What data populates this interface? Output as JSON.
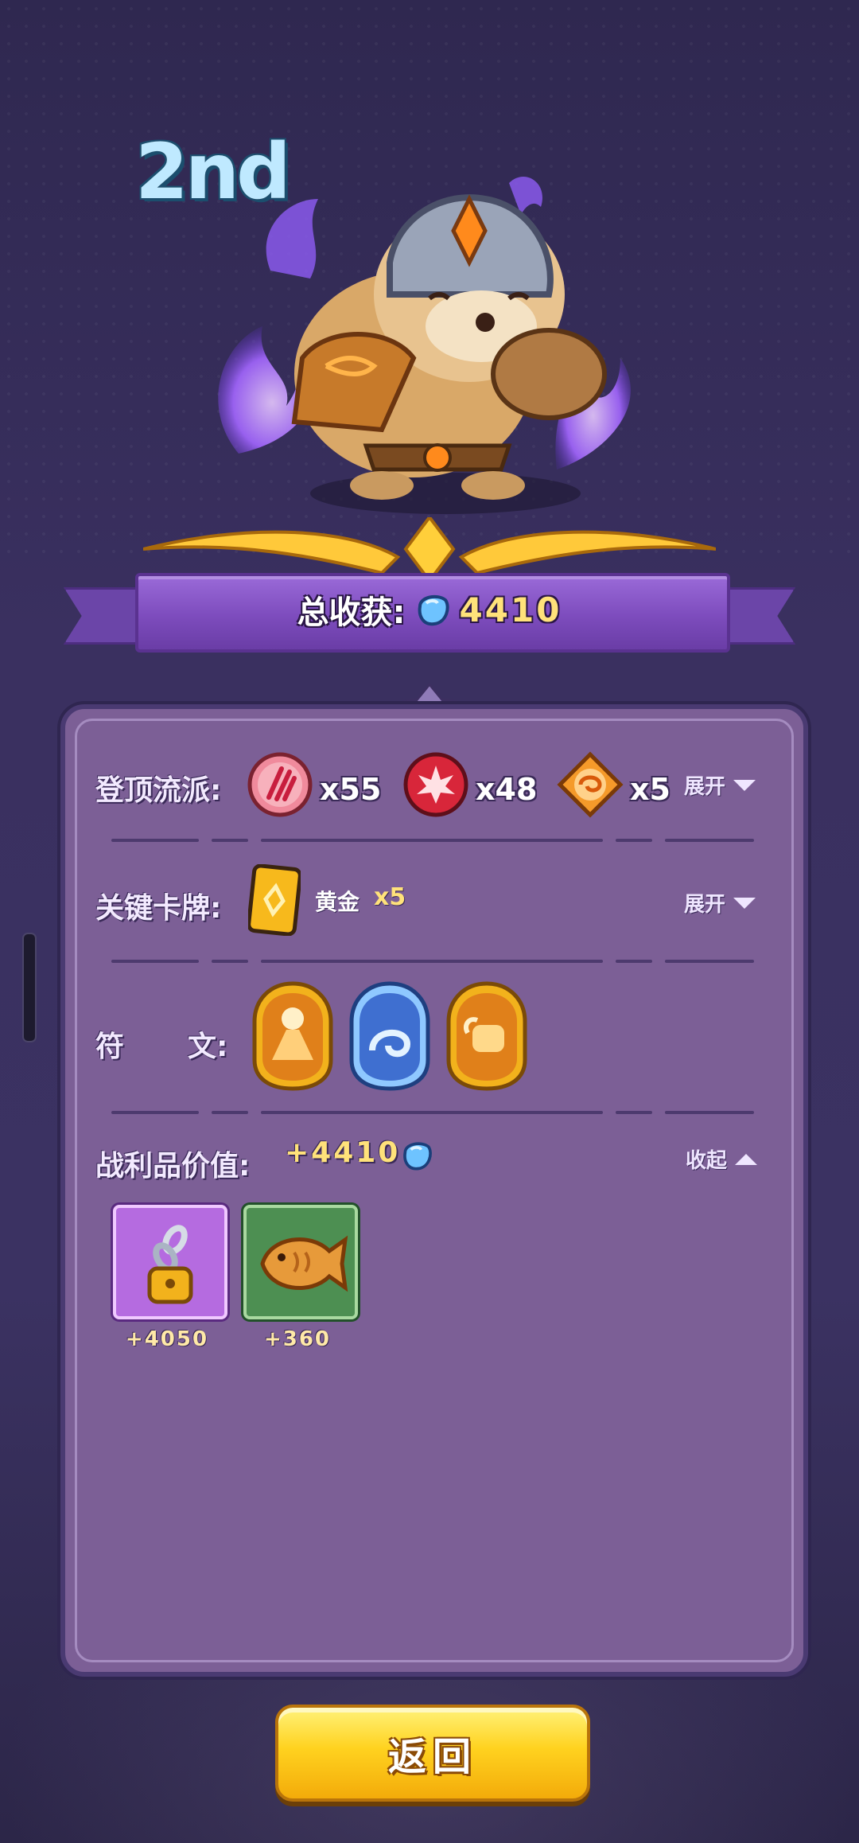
{
  "rank": {
    "text": "2nd"
  },
  "summary": {
    "total_label": "总收获:",
    "total_value": "4410",
    "currency_icon": "blue-gem-icon"
  },
  "rows": {
    "build": {
      "label": "登顶流派:",
      "toggle_label": "展开",
      "items": [
        {
          "icon": "claw-slash-icon",
          "count": "x55"
        },
        {
          "icon": "burst-explosion-icon",
          "count": "x48"
        },
        {
          "icon": "fire-swirl-icon",
          "count": "x5"
        }
      ]
    },
    "key_card": {
      "label": "关键卡牌:",
      "toggle_label": "展开",
      "card_name": "黄金",
      "card_count": "x5",
      "card_icon": "gold-card-icon"
    },
    "runes": {
      "label_left": "符",
      "label_right": "文:",
      "items": [
        {
          "icon": "volcano-rune-icon"
        },
        {
          "icon": "water-splash-rune-icon"
        },
        {
          "icon": "golden-fist-rune-icon"
        }
      ]
    },
    "loot": {
      "label": "战利品价值:",
      "total": "+4410",
      "toggle_label": "收起",
      "items": [
        {
          "icon": "chain-padlock-icon",
          "value": "+4050",
          "bg": "#b56be0"
        },
        {
          "icon": "taiyaki-fish-icon",
          "value": "+360",
          "bg": "#4d8f52"
        }
      ]
    }
  },
  "footer": {
    "return_label": "返回"
  },
  "colors": {
    "accent_gold": "#ffe27a",
    "panel": "#7c5f96",
    "button": "#ffd21f"
  }
}
